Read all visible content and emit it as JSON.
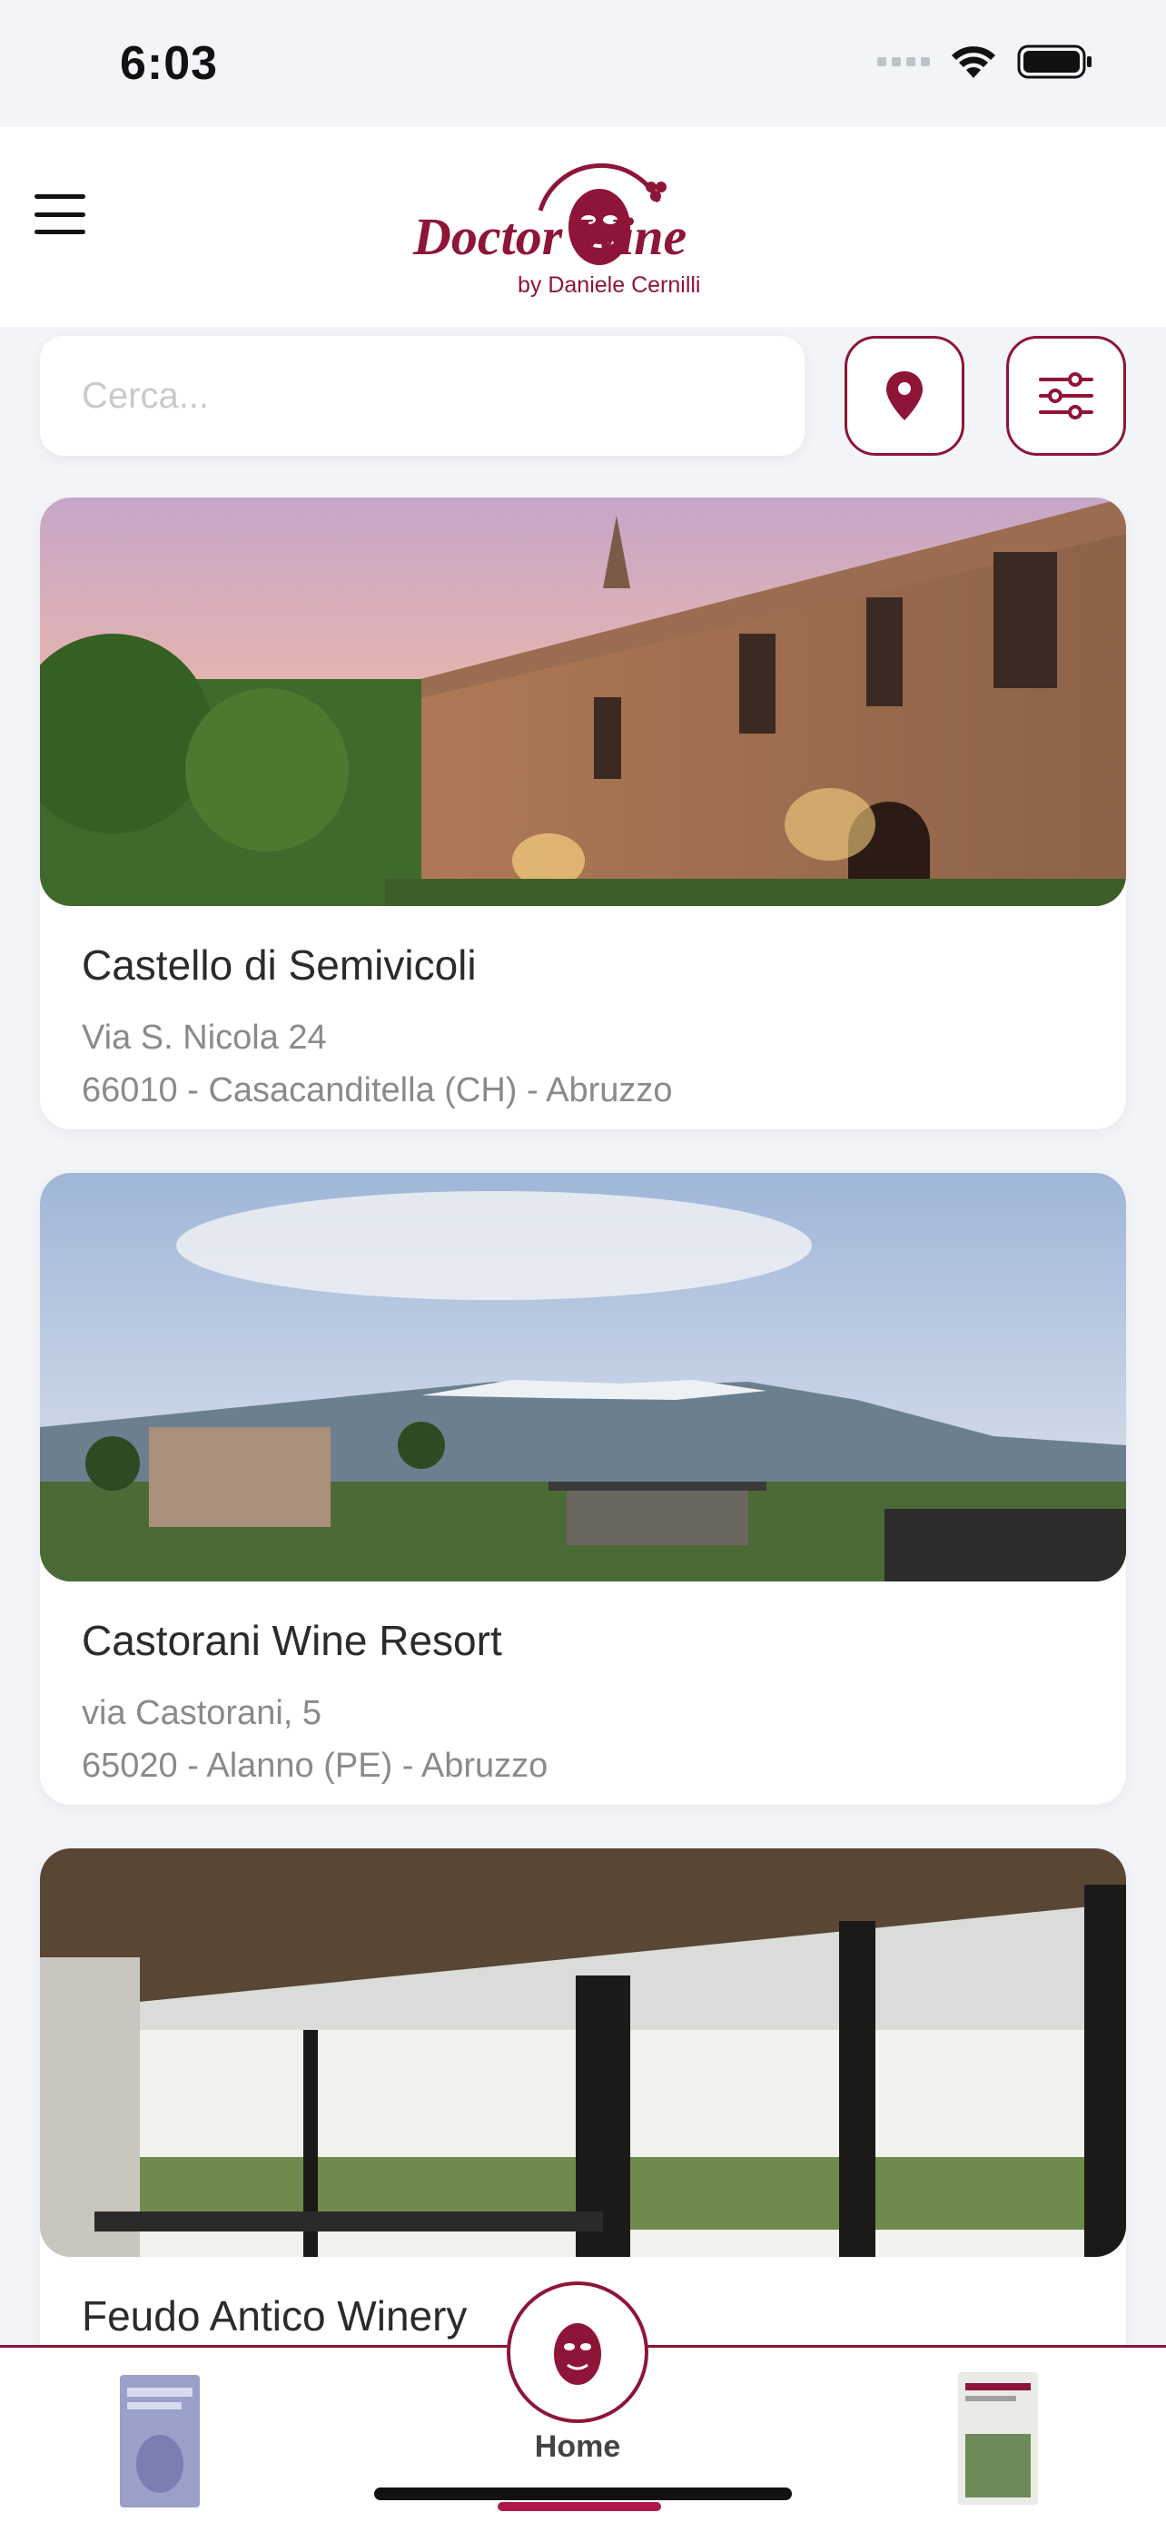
{
  "status_bar": {
    "time": "6:03"
  },
  "header": {
    "logo_text": "Doctor Wine",
    "logo_subtitle": "by Daniele Cernilli"
  },
  "search": {
    "placeholder": "Cerca..."
  },
  "cards": [
    {
      "title": "Castello di Semivicoli",
      "address": "Via S. Nicola 24",
      "locality": "66010 - Casacanditella (CH) - Abruzzo"
    },
    {
      "title": "Castorani Wine Resort",
      "address": "via Castorani, 5",
      "locality": "65020 - Alanno (PE) - Abruzzo"
    },
    {
      "title": "Feudo Antico Winery",
      "address": "",
      "locality": ""
    }
  ],
  "bottom_nav": {
    "home_label": "Home"
  },
  "colors": {
    "brand": "#8e1538",
    "background": "#f2f4f8"
  }
}
